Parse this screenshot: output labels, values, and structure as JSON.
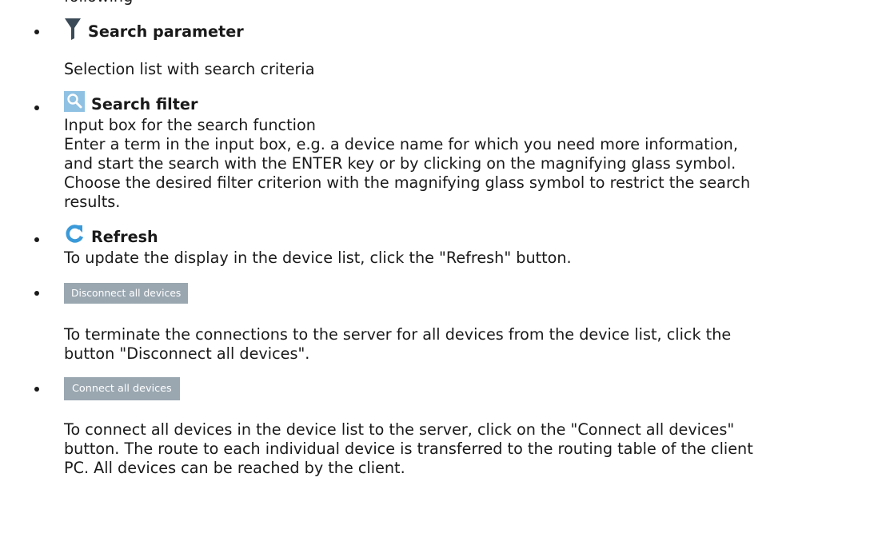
{
  "partial_top": "following",
  "items": [
    {
      "icon": "funnel-icon",
      "label": "Search parameter",
      "lines": [
        "Selection list with search criteria"
      ]
    },
    {
      "icon": "magnifier-icon",
      "label": "Search filter",
      "lines": [
        "Input box for the search function",
        "Enter a term in the input box, e.g. a device name for which you need more information,",
        "and start the search with the ENTER key or by clicking on the magnifying glass symbol.",
        "Choose the desired filter criterion with the magnifying glass symbol to restrict the search",
        "results."
      ]
    },
    {
      "icon": "refresh-icon",
      "label": "Refresh",
      "lines": [
        "To update the display in the device list, click the \"Refresh\" button."
      ]
    },
    {
      "button_label": "Disconnect all devices",
      "lines": [
        "To terminate the connections to the server for all devices from the device list, click the",
        "button \"Disconnect all devices\"."
      ]
    },
    {
      "button_label": "Connect all devices",
      "lines": [
        "To connect all devices in the device list to the server, click on the \"Connect all devices\"",
        "button. The route to each individual device is transferred to the routing table of the client",
        "PC. All devices can be reached by the client."
      ]
    }
  ],
  "colors": {
    "funnel": "#3b4a57",
    "magnifier_bg": "#8fc1e3",
    "refresh": "#3a9ad9",
    "button_bg": "#9aa7b1"
  }
}
